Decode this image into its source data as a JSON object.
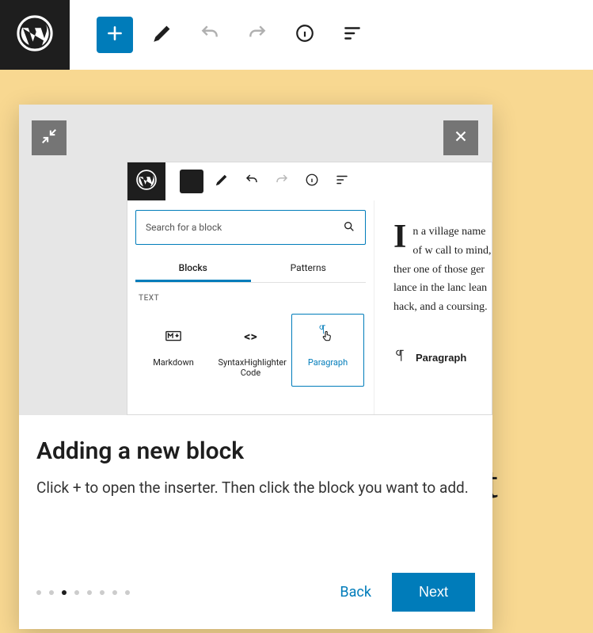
{
  "behind_title_fragment": "t",
  "modal": {
    "title": "Adding a new block",
    "description": "Click + to open the inserter. Then click the block you want to add.",
    "back_label": "Back",
    "next_label": "Next",
    "active_dot_index": 2,
    "total_dots": 8
  },
  "illus": {
    "search_placeholder": "Search for a block",
    "tabs": [
      "Blocks",
      "Patterns"
    ],
    "active_tab_index": 0,
    "section_label": "TEXT",
    "blocks": [
      {
        "name": "Markdown"
      },
      {
        "name": "SyntaxHighlighter Code"
      },
      {
        "name": "Paragraph"
      }
    ],
    "selected_block_index": 2,
    "story": {
      "dropcap": "I",
      "text": "n a village name of w call to mind, ther one of those ger lance in the lanc lean hack, and a coursing."
    },
    "right_marker_label": "Paragraph"
  }
}
